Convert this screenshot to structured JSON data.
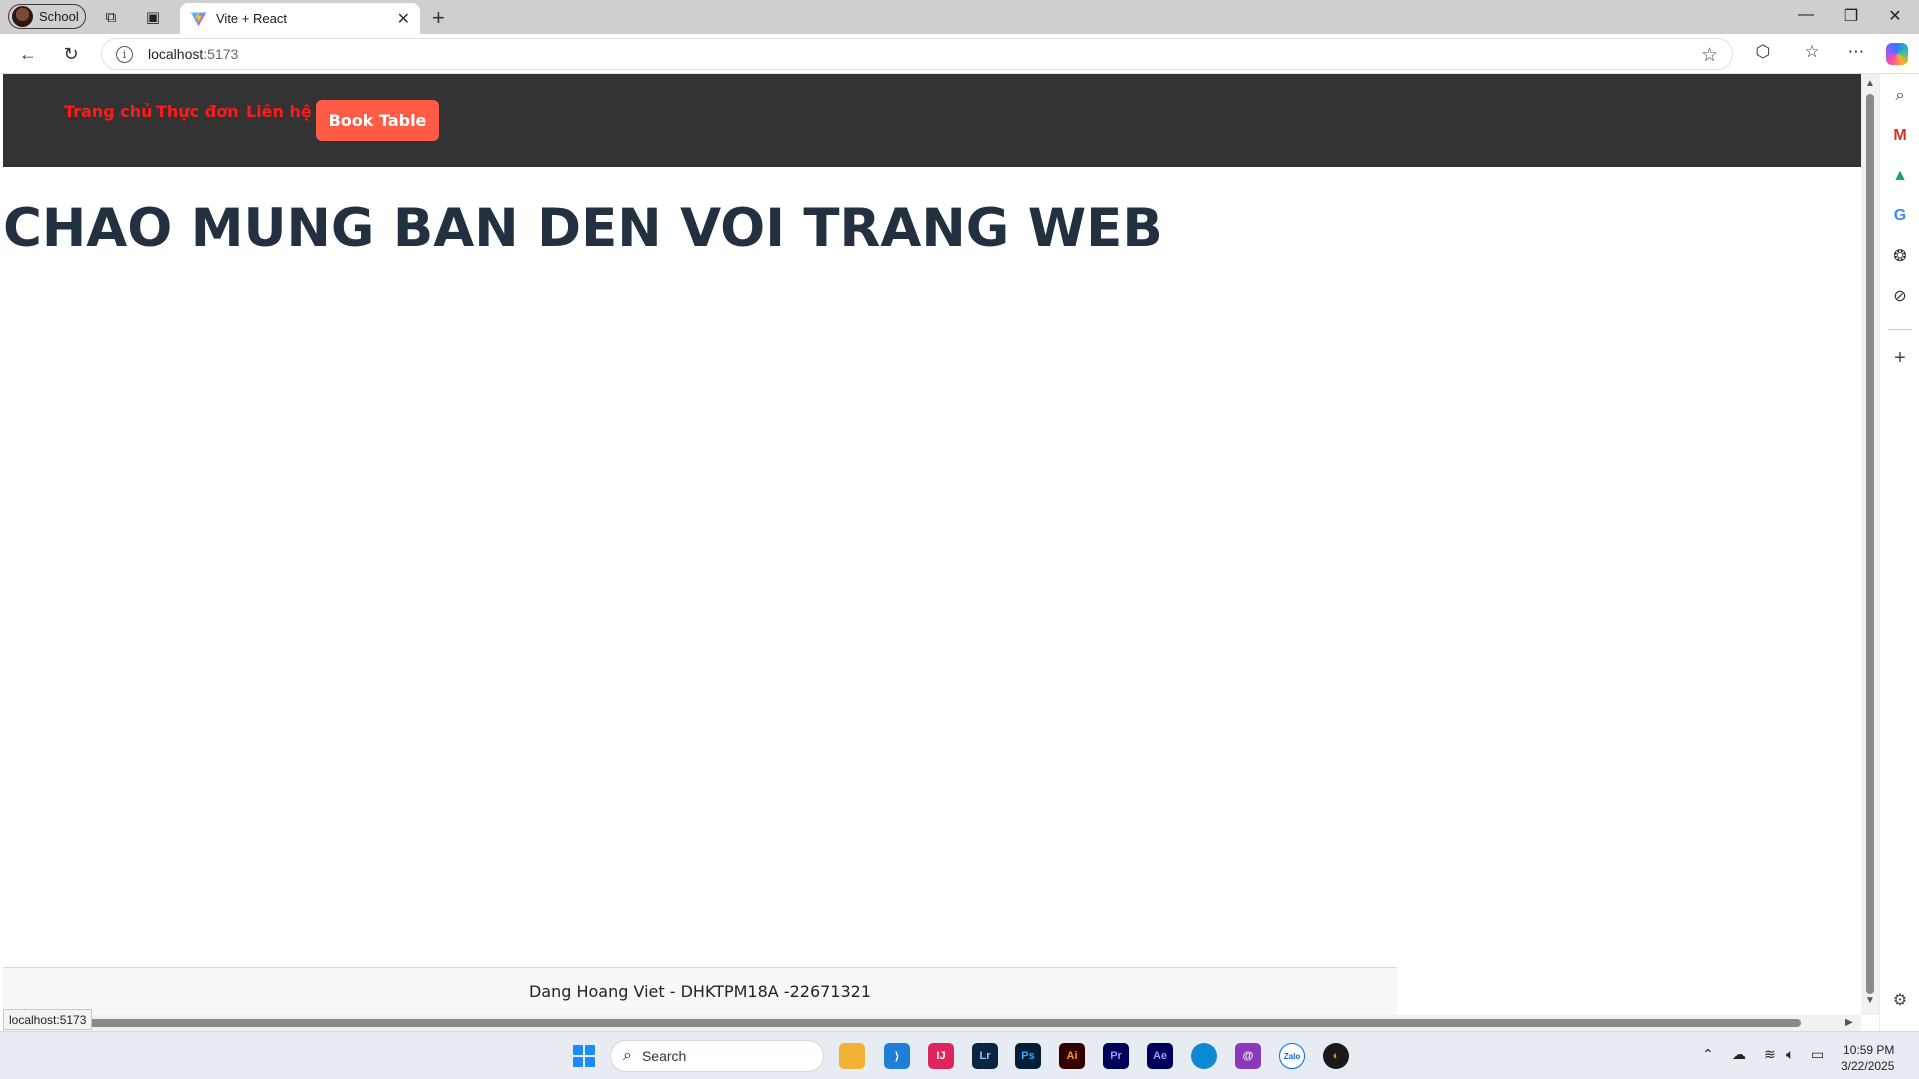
{
  "browser": {
    "profile_label": "School",
    "tab_title": "Vite + React",
    "url_host": "localhost",
    "url_port": ":5173",
    "status_url": "localhost:5173"
  },
  "page": {
    "nav": {
      "links": [
        "Trang chủ",
        "Thực đơn",
        "Liên hệ"
      ],
      "cta_label": "Book Table"
    },
    "hero_title": "CHAO MUNG BAN DEN VOI TRANG WEB",
    "footer_text": "Dang Hoang Viet - DHKTPM18A -22671321"
  },
  "taskbar": {
    "search_placeholder": "Search",
    "time": "10:59 PM",
    "date": "3/22/2025"
  },
  "colors": {
    "navbar_bg": "#333333",
    "nav_link": "#ff1a1a",
    "cta_bg": "#ff5b47",
    "hero_text": "#22303f"
  }
}
